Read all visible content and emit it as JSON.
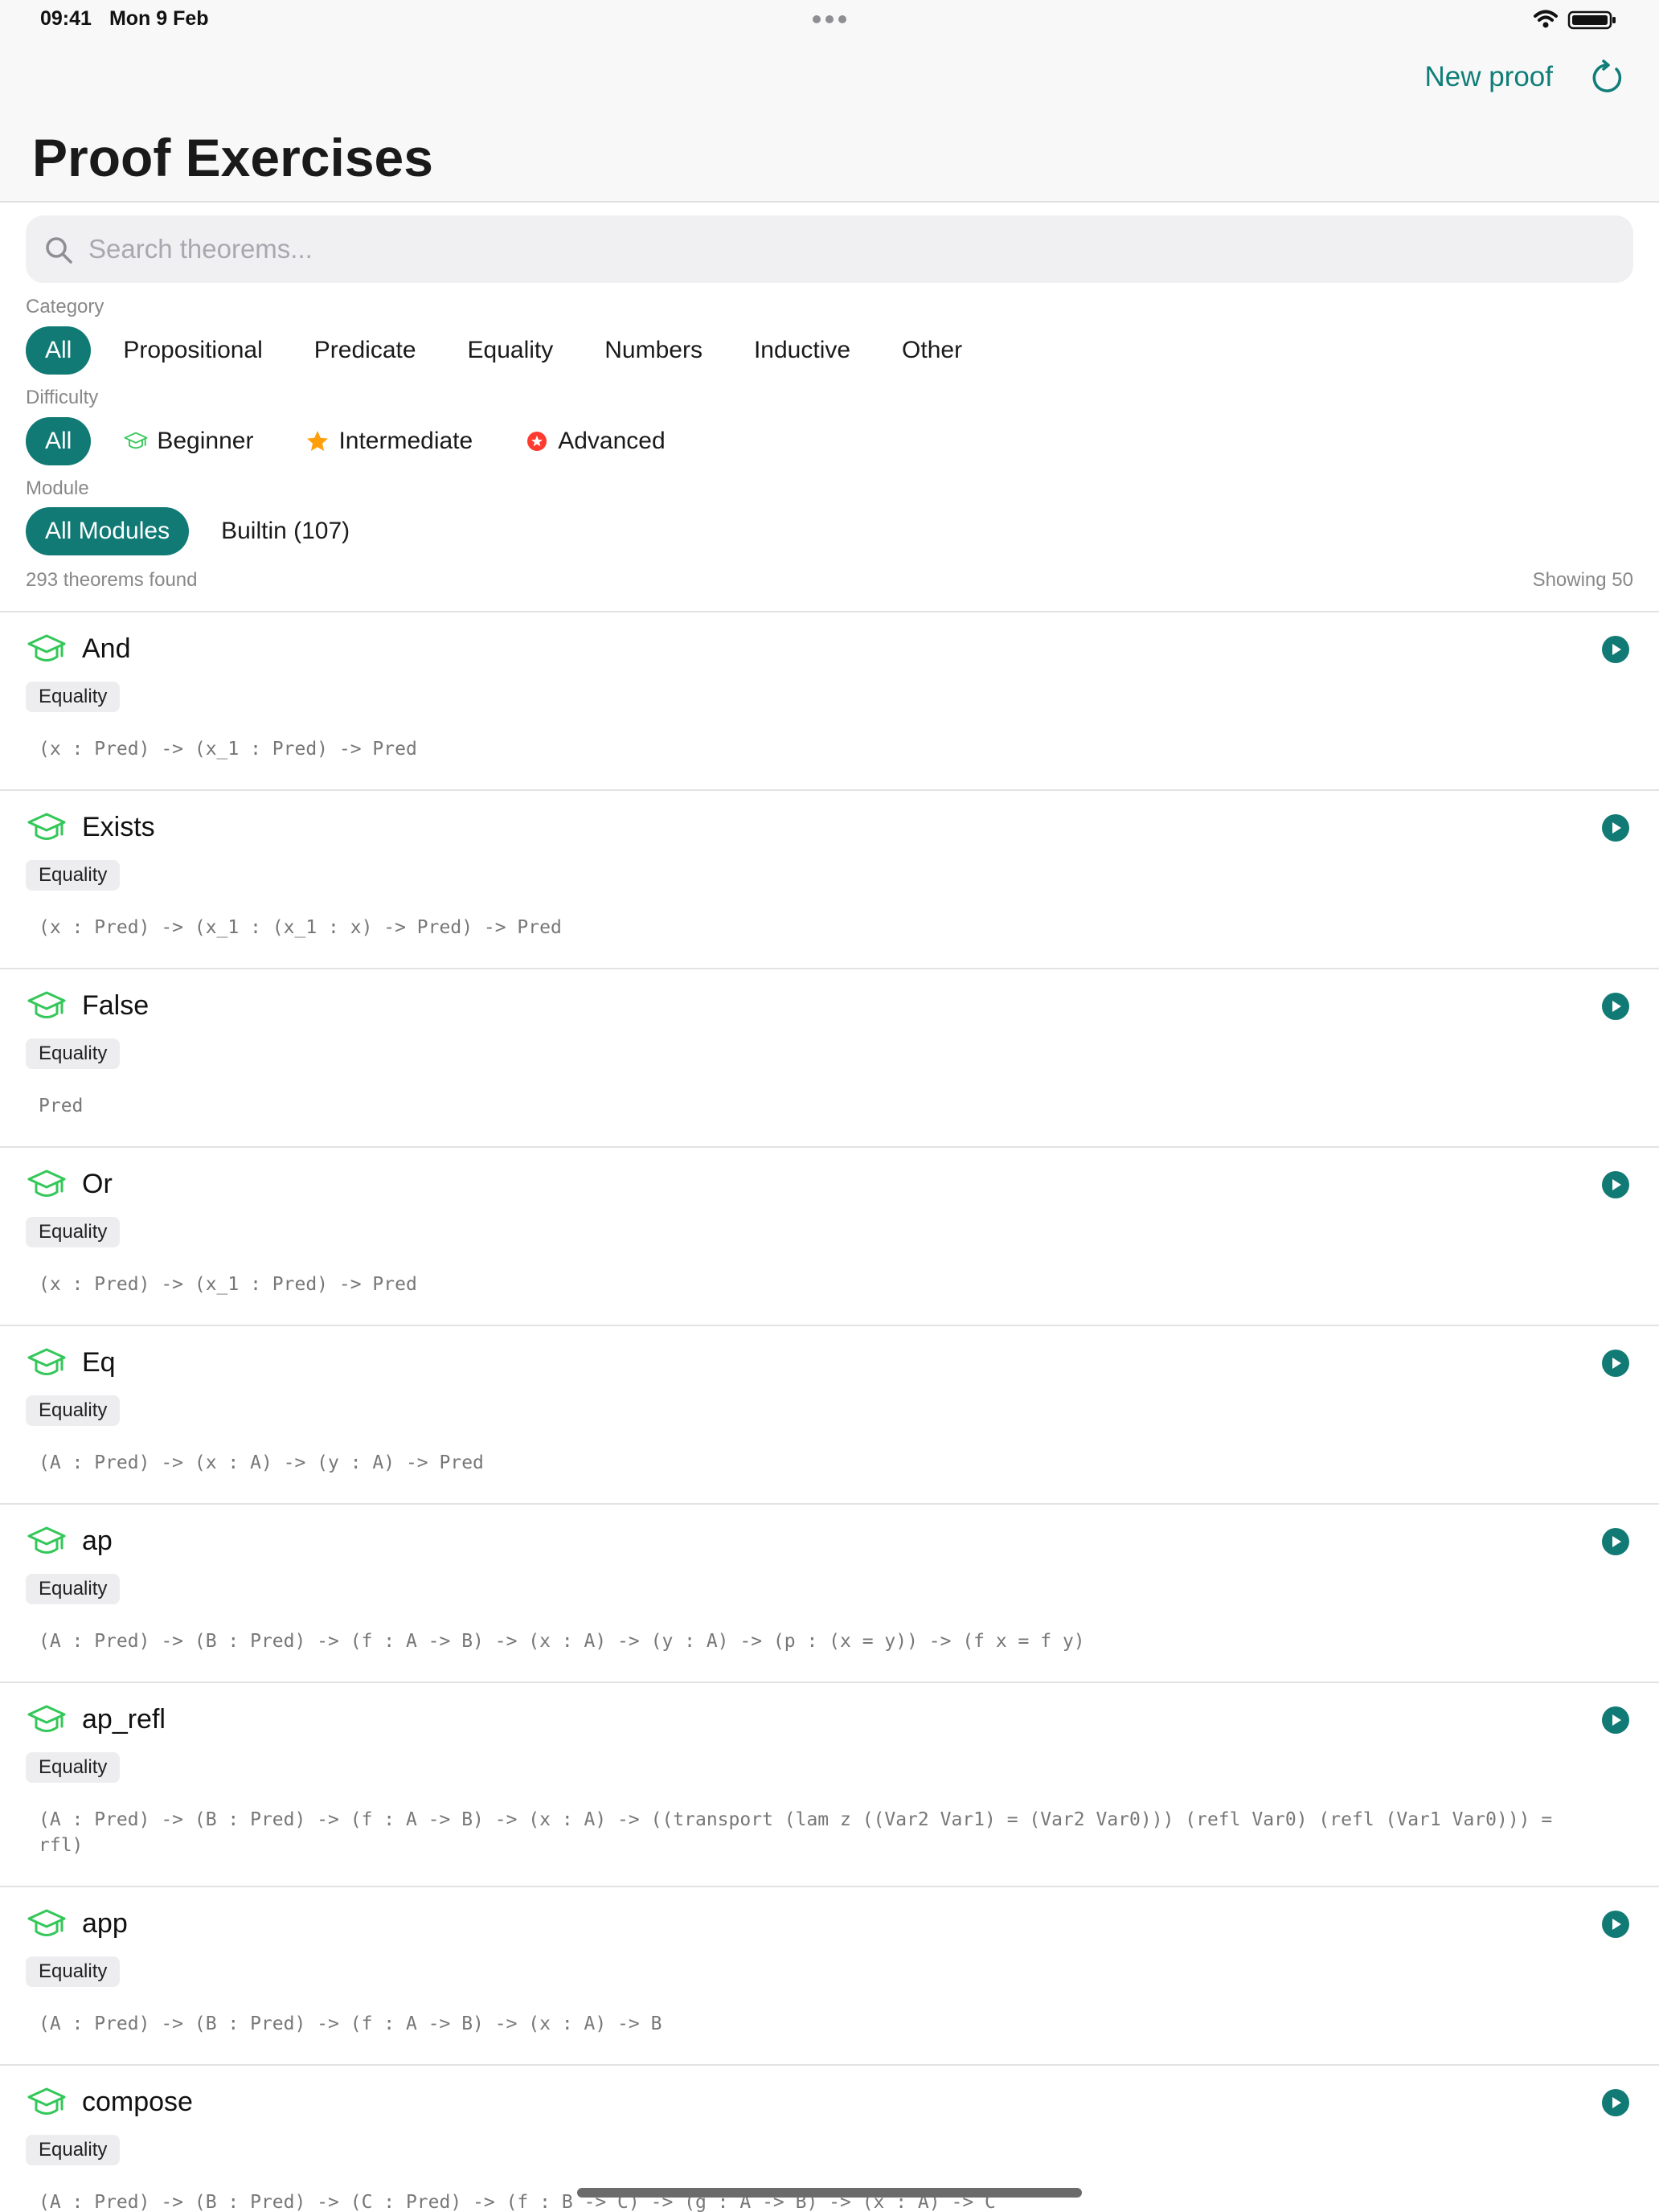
{
  "status": {
    "time": "09:41",
    "date": "Mon 9 Feb"
  },
  "header": {
    "new_proof_label": "New proof",
    "title": "Proof Exercises"
  },
  "search": {
    "placeholder": "Search theorems..."
  },
  "filters": {
    "category": {
      "label": "Category",
      "options": [
        "All",
        "Propositional",
        "Predicate",
        "Equality",
        "Numbers",
        "Inductive",
        "Other"
      ],
      "selected": "All"
    },
    "difficulty": {
      "label": "Difficulty",
      "options": [
        {
          "label": "All",
          "icon": ""
        },
        {
          "label": "Beginner",
          "icon": "graduation-cap-icon"
        },
        {
          "label": "Intermediate",
          "icon": "star-icon"
        },
        {
          "label": "Advanced",
          "icon": "badge-icon"
        }
      ],
      "selected": "All"
    },
    "module": {
      "label": "Module",
      "options": [
        "All Modules",
        "Builtin (107)"
      ],
      "selected": "All Modules"
    }
  },
  "results": {
    "found": "293 theorems found",
    "showing": "Showing 50"
  },
  "theorems": [
    {
      "name": "And",
      "tag": "Equality",
      "signature": "(x : Pred) -> (x_1 : Pred) -> Pred"
    },
    {
      "name": "Exists",
      "tag": "Equality",
      "signature": "(x : Pred) -> (x_1 : (x_1 : x) -> Pred) -> Pred"
    },
    {
      "name": "False",
      "tag": "Equality",
      "signature": "Pred"
    },
    {
      "name": "Or",
      "tag": "Equality",
      "signature": "(x : Pred) -> (x_1 : Pred) -> Pred"
    },
    {
      "name": "Eq",
      "tag": "Equality",
      "signature": "(A : Pred) -> (x : A) -> (y : A) -> Pred"
    },
    {
      "name": "ap",
      "tag": "Equality",
      "signature": "(A : Pred) -> (B : Pred) -> (f : A -> B) -> (x : A) -> (y : A) -> (p : (x = y)) -> (f x = f y)"
    },
    {
      "name": "ap_refl",
      "tag": "Equality",
      "signature": "(A : Pred) -> (B : Pred) -> (f : A -> B) -> (x : A) -> ((transport (lam z ((Var2 Var1) = (Var2 Var0))) (refl Var0) (refl (Var1 Var0))) = rfl)"
    },
    {
      "name": "app",
      "tag": "Equality",
      "signature": "(A : Pred) -> (B : Pred) -> (f : A -> B) -> (x : A) -> B"
    },
    {
      "name": "compose",
      "tag": "Equality",
      "signature": "(A : Pred) -> (B : Pred) -> (C : Pred) -> (f : B -> C) -> (g : A -> B) -> (x : A) -> C"
    }
  ],
  "colors": {
    "accent": "#117a75",
    "beginner": "#34c759",
    "intermediate": "#ff9f0a",
    "advanced": "#ff3b30"
  }
}
